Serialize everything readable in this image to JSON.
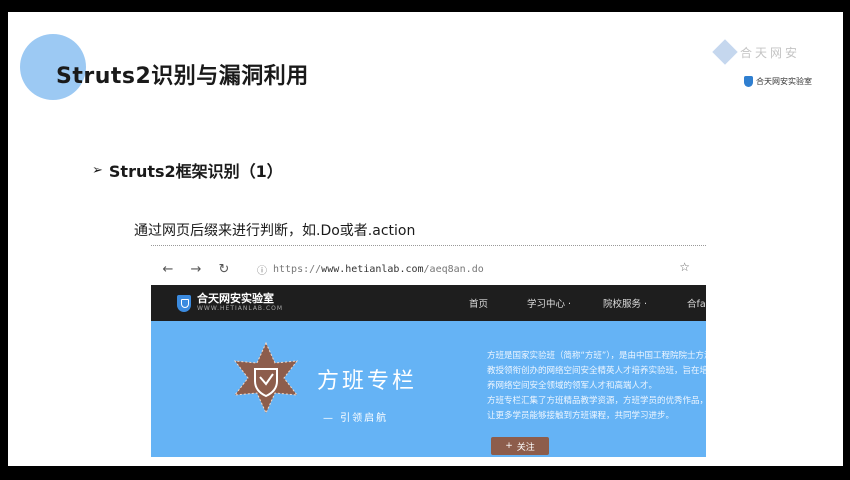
{
  "slide": {
    "title": "Struts2识别与漏洞利用",
    "bullet": "Struts2框架识别（1）",
    "description": "通过网页后缀来进行判断，如.Do或者.action"
  },
  "corner_logo": {
    "faded_text": "合天网安",
    "brand": "合天网安实验室"
  },
  "browser": {
    "back_icon": "←",
    "forward_icon": "→",
    "reload_icon": "↻",
    "secure_icon": "ⓘ",
    "url_prefix": "https://",
    "url_host": "www.hetianlab.com",
    "url_path": "/aeq8an.do",
    "star_icon": "☆"
  },
  "site": {
    "name": "合天网安实验室",
    "sub": "WWW.HETIANLAB.COM",
    "nav": [
      "首页",
      "学习中心 ·",
      "院校服务 ·",
      "合fans"
    ]
  },
  "banner": {
    "title": "方班专栏",
    "subtitle": "— 引领启航",
    "intro_lines": [
      "方班是国家实验班（简称“方班”），是由中国工程院院士方滨兴",
      "教授领衔创办的网络空间安全精英人才培养实验班，旨在培",
      "养网络空间安全领域的领军人才和高端人才。",
      "方班专栏汇集了方班精品教学资源，方班学员的优秀作品，",
      "让更多学员能够接触到方班课程，共同学习进步。"
    ],
    "follow_icon": "+",
    "follow_label": "关注"
  },
  "colors": {
    "accent_circle": "#9cc9f3",
    "banner_blue": "#65b3f5",
    "site_bar": "#1e1e1e",
    "badge_brown": "#8d5d4c"
  }
}
